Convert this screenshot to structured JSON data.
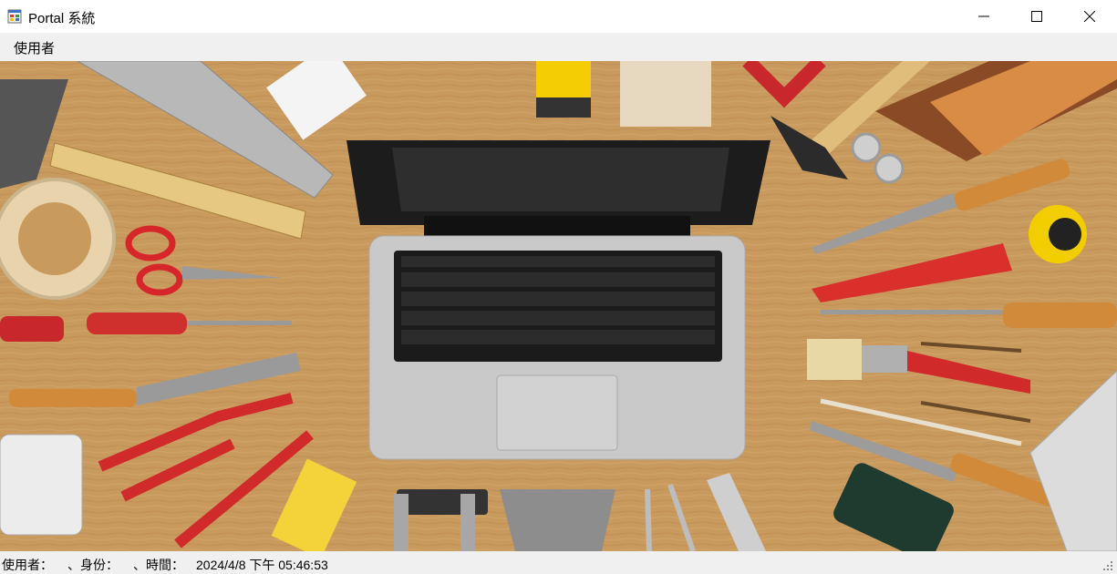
{
  "window": {
    "title": "Portal 系統",
    "app_icon": "app-window-icon"
  },
  "window_controls": {
    "minimize": "minimize-icon",
    "maximize": "maximize-icon",
    "close": "close-icon"
  },
  "menu": {
    "items": [
      {
        "label": "使用者"
      }
    ]
  },
  "background_image": {
    "subject": "laptop on wooden workbench surrounded by tools"
  },
  "status": {
    "user_label": "使用者：",
    "user_value": "",
    "role_label": "、身份：",
    "role_value": "",
    "time_label": "、時間：",
    "time_value": "2024/4/8 下午 05:46:53"
  },
  "colors": {
    "wood": "#c99a5e",
    "laptop": "#c9c9c9",
    "statusbar": "#f0f0f0"
  }
}
